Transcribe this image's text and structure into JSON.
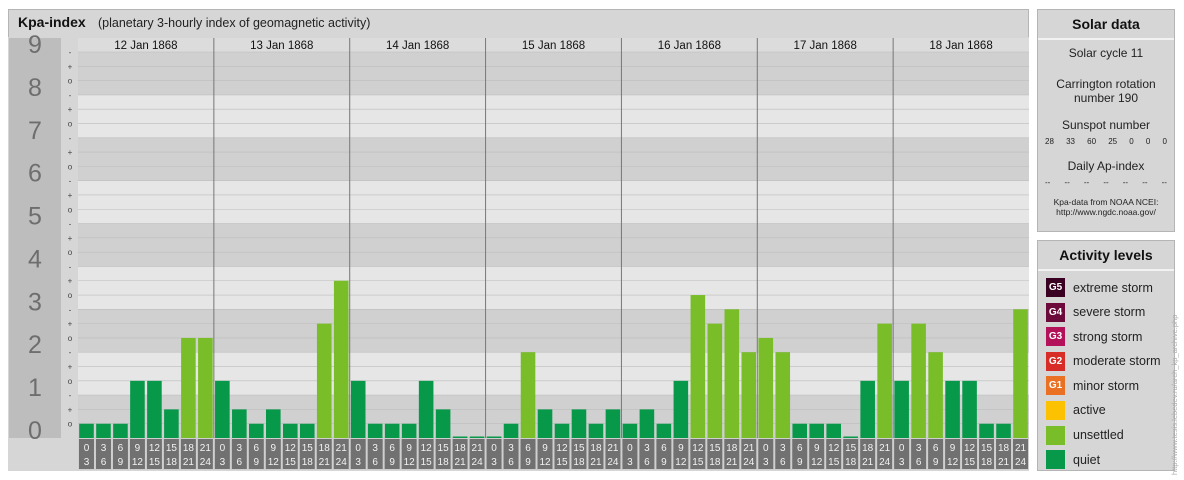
{
  "chart_data": {
    "type": "bar",
    "title": "Kpa-index",
    "subtitle": "(planetary 3-hourly index of geomagnetic activity)",
    "ylim": [
      0,
      9
    ],
    "y_major_labels": [
      "0",
      "1",
      "2",
      "3",
      "4",
      "5",
      "6",
      "7",
      "8",
      "9"
    ],
    "y_minor_labels": [
      "-",
      "o",
      "+"
    ],
    "days": [
      "12 Jan 1868",
      "13 Jan 1868",
      "14 Jan 1868",
      "15 Jan 1868",
      "16 Jan 1868",
      "17 Jan 1868",
      "18 Jan 1868"
    ],
    "interval_start_labels": [
      "0",
      "3",
      "6",
      "9",
      "12",
      "15",
      "18",
      "21"
    ],
    "interval_end_labels": [
      "3",
      "6",
      "9",
      "12",
      "15",
      "18",
      "21",
      "24"
    ],
    "values": [
      0.333,
      0.333,
      0.333,
      1.333,
      1.333,
      0.667,
      2.333,
      2.333,
      1.333,
      0.667,
      0.333,
      0.667,
      0.333,
      0.333,
      2.667,
      3.667,
      1.333,
      0.333,
      0.333,
      0.333,
      1.333,
      0.667,
      0,
      0,
      0,
      0.333,
      2,
      0.667,
      0.333,
      0.667,
      0.333,
      0.667,
      0.333,
      0.667,
      0.333,
      1.333,
      3.333,
      2.667,
      3,
      2,
      2.333,
      2,
      0.333,
      0.333,
      0.333,
      0,
      1.333,
      2.667,
      1.333,
      2.667,
      2,
      1.333,
      1.333,
      0.333,
      0.333,
      3
    ],
    "level_colors": {
      "quiet": "#079849",
      "unsettled": "#79bd29",
      "active": "#fcc100",
      "minor storm": "#ea7123",
      "moderate storm": "#d82d27",
      "strong storm": "#b3125b",
      "severe storm": "#6d0a3c",
      "extreme storm": "#3a0021"
    },
    "band_colors": [
      "#d0d0d0",
      "#e6e6e6"
    ],
    "grid": true
  },
  "solar": {
    "title": "Solar data",
    "cycle": "Solar cycle 11",
    "rotation_line1": "Carrington rotation",
    "rotation_line2": "number 190",
    "sunspot_title": "Sunspot number",
    "sunspot_values": [
      "28",
      "33",
      "60",
      "25",
      "0",
      "0",
      "0"
    ],
    "ap_title": "Daily Ap-index",
    "ap_values": [
      "--",
      "--",
      "--",
      "--",
      "--",
      "--",
      "--"
    ],
    "note_line1": "Kpa-data from NOAA NCEI:",
    "note_line2": "http://www.ngdc.noaa.gov/"
  },
  "activity": {
    "title": "Activity levels",
    "levels": [
      {
        "badge": "G5",
        "label": "extreme storm",
        "color": "#3a0021"
      },
      {
        "badge": "G4",
        "label": "severe storm",
        "color": "#6d0a3c"
      },
      {
        "badge": "G3",
        "label": "strong storm",
        "color": "#b3125b"
      },
      {
        "badge": "G2",
        "label": "moderate storm",
        "color": "#d82d27"
      },
      {
        "badge": "G1",
        "label": "minor storm",
        "color": "#ea7123"
      },
      {
        "badge": "",
        "label": "active",
        "color": "#fcc100"
      },
      {
        "badge": "",
        "label": "unsettled",
        "color": "#79bd29"
      },
      {
        "badge": "",
        "label": "quiet",
        "color": "#079849"
      }
    ]
  },
  "credit": "http://www.tesis.lebedev.ru/arch_kp_archive.php"
}
